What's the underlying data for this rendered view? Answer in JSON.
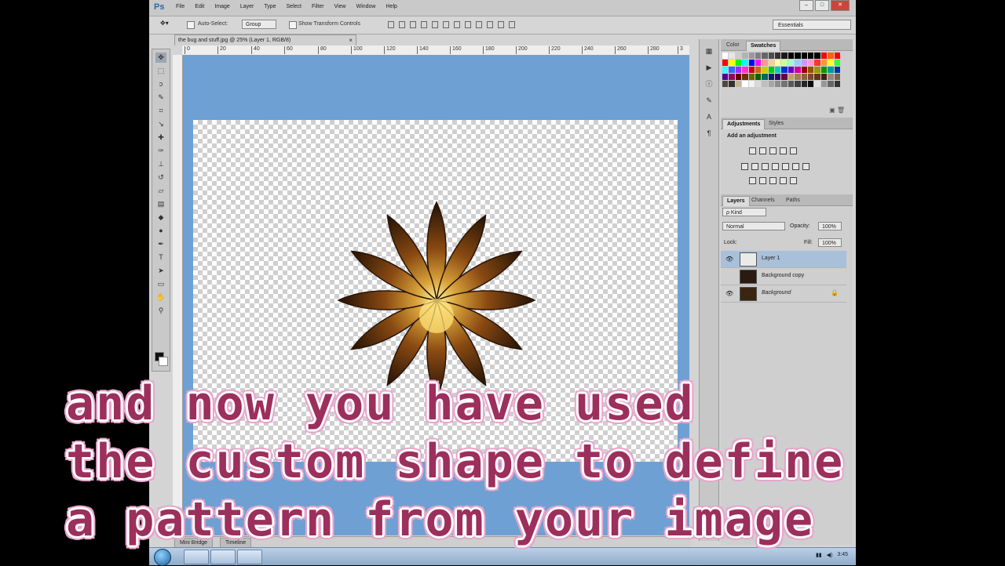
{
  "app": {
    "logo": "Ps",
    "menu": [
      "File",
      "Edit",
      "Image",
      "Layer",
      "Type",
      "Select",
      "Filter",
      "View",
      "Window",
      "Help"
    ],
    "window_buttons": [
      "–",
      "□",
      "✕"
    ]
  },
  "options_bar": {
    "auto_select_label": "Auto-Select:",
    "auto_select_value": "Group",
    "transform_controls_label": "Show Transform Controls",
    "workspace": "Essentials"
  },
  "document": {
    "tab_title": "the bug and stuff.jpg @ 25% (Layer 1, RGB/8)",
    "tab_close": "×",
    "ruler_ticks": [
      "0",
      "20",
      "40",
      "60",
      "80",
      "100",
      "120",
      "140",
      "160",
      "180",
      "200",
      "220",
      "240",
      "260",
      "280",
      "3"
    ]
  },
  "status_bar": {
    "tabs": [
      "Mini Bridge",
      "Timeline"
    ]
  },
  "swatches_panel": {
    "tabs": [
      "Color",
      "Swatches"
    ],
    "active_tab": "Swatches",
    "colors": [
      "#ffffff",
      "#e6e6e6",
      "#cccccc",
      "#b3b3b3",
      "#999999",
      "#808080",
      "#666666",
      "#4d4d4d",
      "#333333",
      "#1a1a1a",
      "#000000",
      "#000000",
      "#000000",
      "#000000",
      "#000000",
      "#ff0000",
      "#ff6600",
      "#ff0000",
      "#ff0000",
      "#ffff00",
      "#00ff00",
      "#00ffff",
      "#0000ff",
      "#ff00ff",
      "#ff9999",
      "#ffcc99",
      "#ffff99",
      "#ccff99",
      "#99ffcc",
      "#99ccff",
      "#cc99ff",
      "#ff99cc",
      "#ff3333",
      "#ff9933",
      "#ffff33",
      "#33ff33",
      "#33ffff",
      "#3366ff",
      "#9933ff",
      "#ff33cc",
      "#cc0000",
      "#cc6600",
      "#cccc00",
      "#00cc00",
      "#00cccc",
      "#0033cc",
      "#6600cc",
      "#cc0099",
      "#990000",
      "#994c00",
      "#999900",
      "#009900",
      "#009999",
      "#003399",
      "#4c0099",
      "#990066",
      "#660000",
      "#663300",
      "#666600",
      "#006600",
      "#006666",
      "#002266",
      "#330066",
      "#660044",
      "#c69c6d",
      "#a67c52",
      "#8c6239",
      "#754c24",
      "#603813",
      "#42210b",
      "#998675",
      "#736357",
      "#534741",
      "#362f2d",
      "#c7b299",
      "#ffffff",
      "#f2f2f2",
      "#d9d9d9",
      "#bfbfbf",
      "#a6a6a6",
      "#8c8c8c",
      "#737373",
      "#595959",
      "#404040",
      "#262626",
      "#0d0d0d",
      "#e0e0e0",
      "#999999",
      "#666666",
      "#333333"
    ]
  },
  "adjustments_panel": {
    "tabs": [
      "Adjustments",
      "Styles"
    ],
    "active_tab": "Adjustments",
    "title": "Add an adjustment"
  },
  "layers_panel": {
    "tabs": [
      "Layers",
      "Channels",
      "Paths"
    ],
    "active_tab": "Layers",
    "filter": "ρ Kind",
    "blend_mode": "Normal",
    "opacity_label": "Opacity:",
    "opacity_value": "100%",
    "lock_label": "Lock:",
    "fill_label": "Fill:",
    "fill_value": "100%",
    "layers": [
      {
        "name": "Layer 1",
        "selected": true,
        "visible": true,
        "locked": false
      },
      {
        "name": "Background copy",
        "selected": false,
        "visible": false,
        "locked": false
      },
      {
        "name": "Background",
        "selected": false,
        "visible": true,
        "locked": true
      }
    ]
  },
  "taskbar": {
    "clock": "3:45"
  },
  "caption": {
    "line1": "and now you have used",
    "line2": "the custom shape to define",
    "line3": "a pattern from your image"
  },
  "colors": {
    "canvas_bg": "#6fa0d3",
    "caption_text": "#9c2f5c",
    "caption_outline": "#e7a5cd",
    "selected_layer": "#a9c0da"
  }
}
